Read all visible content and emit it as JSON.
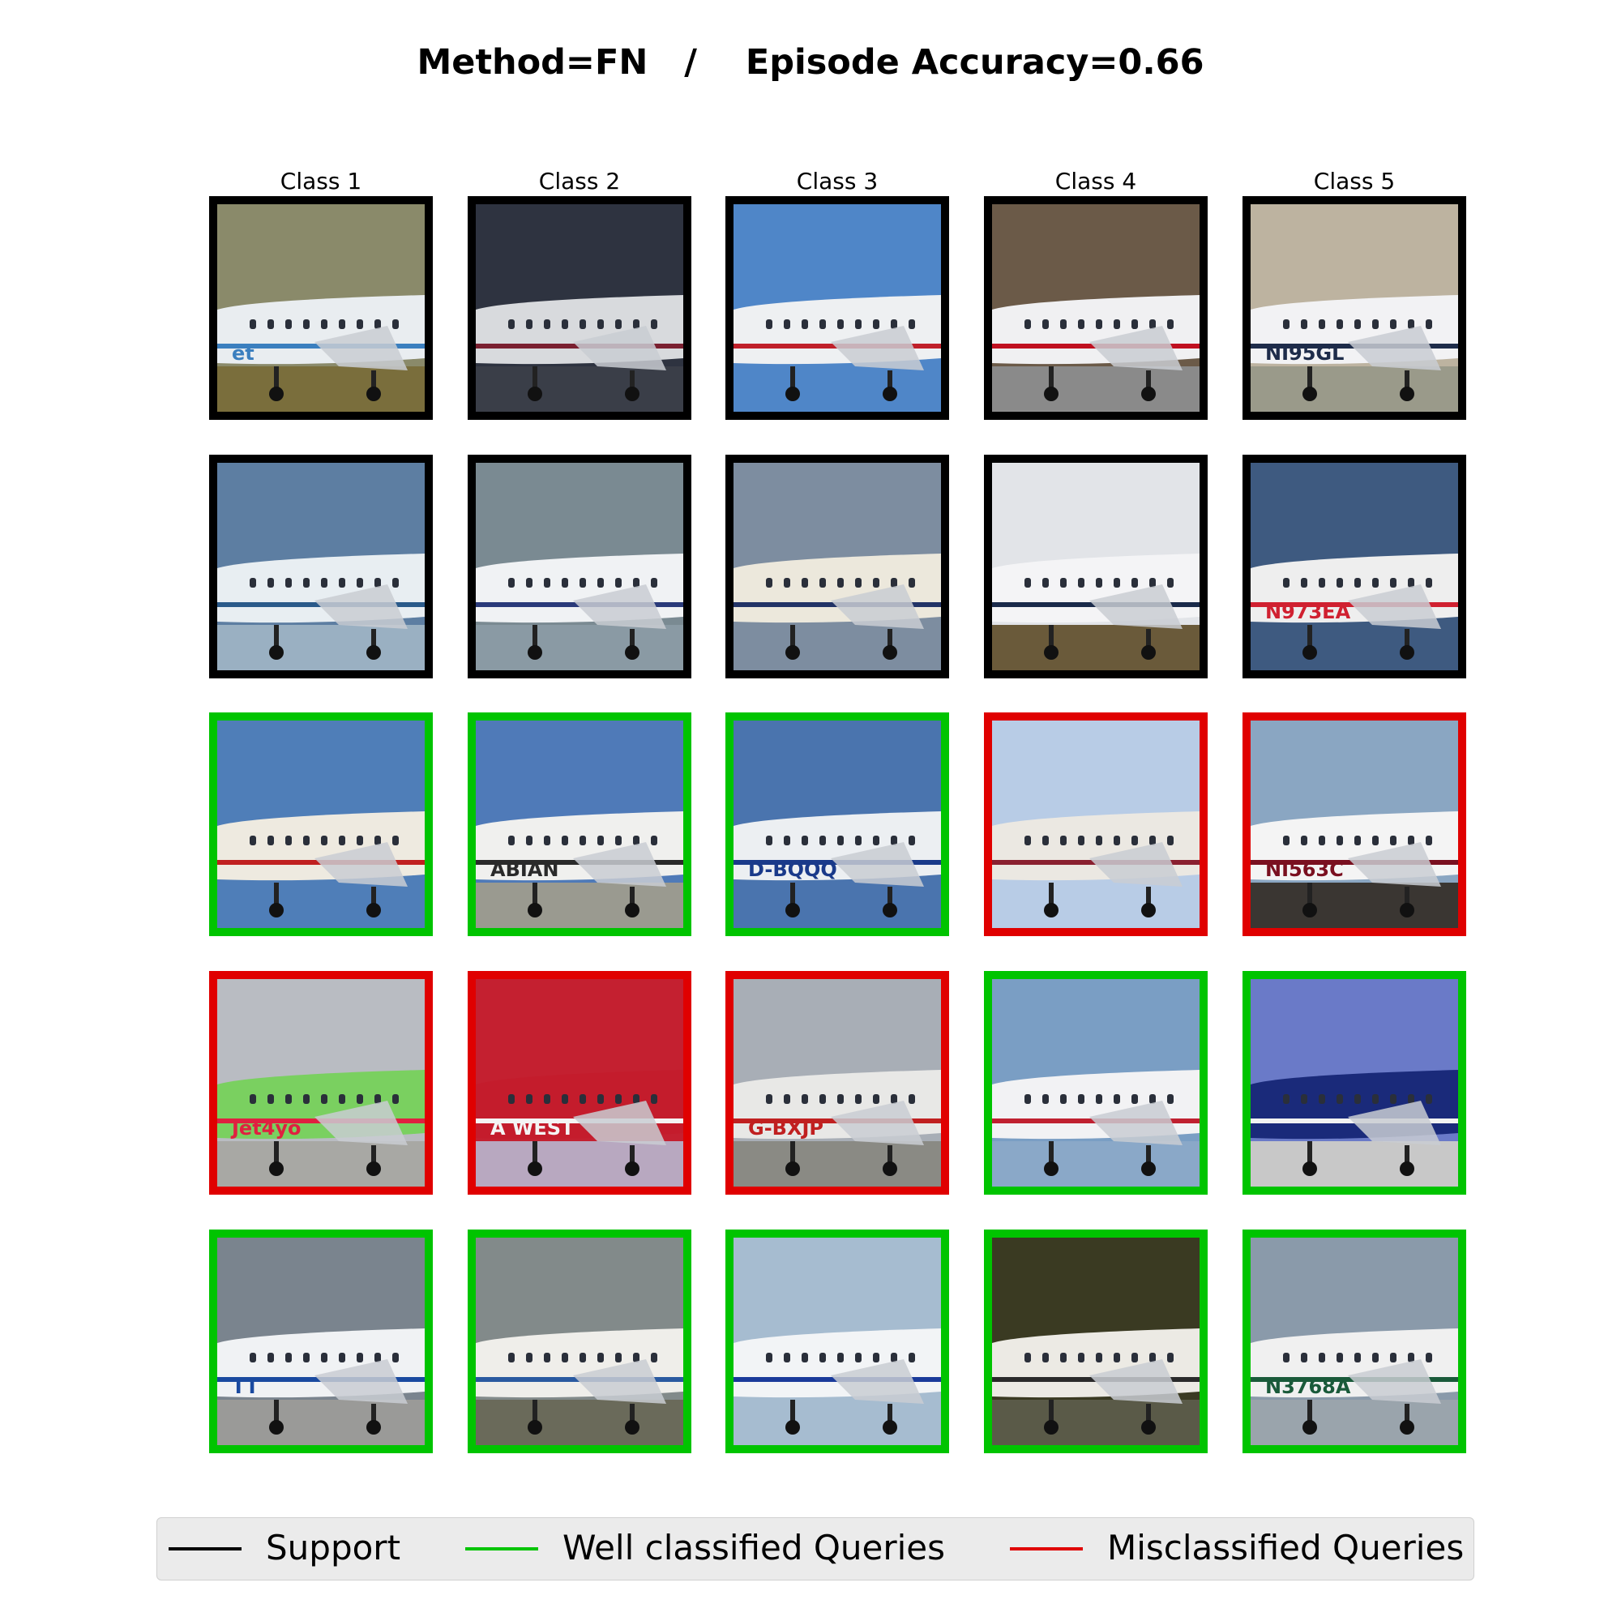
{
  "title": "Method=FN   /    Episode Accuracy=0.66",
  "columns": [
    "Class 1",
    "Class 2",
    "Class 3",
    "Class 4",
    "Class 5"
  ],
  "colors": {
    "support": "#000000",
    "well_classified": "#00c400",
    "misclassified": "#e00000"
  },
  "legend": [
    {
      "label": "Support",
      "color": "#000000"
    },
    {
      "label": "Well classified Queries",
      "color": "#00c400"
    },
    {
      "label": "Misclassified Queries",
      "color": "#e00000"
    }
  ],
  "grid": [
    [
      {
        "status": "support",
        "sky": "#8a8a6a",
        "ground": "#7a6e3c",
        "body": "#e9edf0",
        "stripe": "#3b7fbf",
        "text": "et"
      },
      {
        "status": "support",
        "sky": "#2e3340",
        "ground": "#3a3e48",
        "body": "#d8dadd",
        "stripe": "#7a2030",
        "text": ""
      },
      {
        "status": "support",
        "sky": "#4f86c8",
        "ground": "#4f86c8",
        "body": "#eef0f2",
        "stripe": "#c0202a",
        "text": ""
      },
      {
        "status": "support",
        "sky": "#6b5a48",
        "ground": "#8a8a8a",
        "body": "#f0f0f2",
        "stripe": "#c01020",
        "text": ""
      },
      {
        "status": "support",
        "sky": "#bdb3a0",
        "ground": "#9a9a8a",
        "body": "#f2f2f4",
        "stripe": "#1e2c4a",
        "text": "NI95GL"
      }
    ],
    [
      {
        "status": "support",
        "sky": "#5d7ea2",
        "ground": "#9ab0c2",
        "body": "#e8eef2",
        "stripe": "#2a5a8a",
        "text": ""
      },
      {
        "status": "support",
        "sky": "#7a8a92",
        "ground": "#8a9aa4",
        "body": "#f0f2f4",
        "stripe": "#2a3a7a",
        "text": ""
      },
      {
        "status": "support",
        "sky": "#7d8da0",
        "ground": "#7d8da0",
        "body": "#ece8dc",
        "stripe": "#223366",
        "text": ""
      },
      {
        "status": "support",
        "sky": "#e2e4e8",
        "ground": "#6a5a3a",
        "body": "#f4f4f6",
        "stripe": "#1a2a4a",
        "text": ""
      },
      {
        "status": "support",
        "sky": "#3e5a80",
        "ground": "#3e5a80",
        "body": "#eeeeee",
        "stripe": "#d02030",
        "text": "N973EA"
      }
    ],
    [
      {
        "status": "correct",
        "sky": "#4f7eb8",
        "ground": "#4f7eb8",
        "body": "#eeeae0",
        "stripe": "#c02020",
        "text": ""
      },
      {
        "status": "correct",
        "sky": "#4f7ab8",
        "ground": "#9a9a90",
        "body": "#f0f0ee",
        "stripe": "#2a2a2a",
        "text": "ABIAN"
      },
      {
        "status": "correct",
        "sky": "#4a74ae",
        "ground": "#4a74ae",
        "body": "#eceff2",
        "stripe": "#1a3a8a",
        "text": "D-BQQQ"
      },
      {
        "status": "wrong",
        "sky": "#b8cce6",
        "ground": "#b8cce6",
        "body": "#ebe8e2",
        "stripe": "#8a2030",
        "text": ""
      },
      {
        "status": "wrong",
        "sky": "#8aa6c2",
        "ground": "#3a3632",
        "body": "#f4f4f4",
        "stripe": "#7a1020",
        "text": "NI563C"
      }
    ],
    [
      {
        "status": "wrong",
        "sky": "#b9bcc2",
        "ground": "#a8a8a4",
        "body": "#7ad060",
        "stripe": "#e02040",
        "text": "Jet4yo"
      },
      {
        "status": "wrong",
        "sky": "#c42030",
        "ground": "#b8a8c0",
        "body": "#c41c2c",
        "stripe": "#f4f4f4",
        "text": "A WEST"
      },
      {
        "status": "wrong",
        "sky": "#a8aeb6",
        "ground": "#8a8a84",
        "body": "#e8e8e6",
        "stripe": "#c02020",
        "text": "G-BXJP"
      },
      {
        "status": "correct",
        "sky": "#7a9ec4",
        "ground": "#8aa8c8",
        "body": "#f2f2f4",
        "stripe": "#c02030",
        "text": ""
      },
      {
        "status": "correct",
        "sky": "#6a7ac8",
        "ground": "#c8c8c8",
        "body": "#1a2a7a",
        "stripe": "#f2f2f2",
        "text": ""
      }
    ],
    [
      {
        "status": "correct",
        "sky": "#7a848e",
        "ground": "#9a9a98",
        "body": "#f0f2f4",
        "stripe": "#1a4aa0",
        "text": "TT"
      },
      {
        "status": "correct",
        "sky": "#828a8a",
        "ground": "#6a6a5a",
        "body": "#efeeea",
        "stripe": "#2a5aa0",
        "text": ""
      },
      {
        "status": "correct",
        "sky": "#a6bcd0",
        "ground": "#a6bcd0",
        "body": "#f2f4f6",
        "stripe": "#1a3a9a",
        "text": ""
      },
      {
        "status": "correct",
        "sky": "#3a3a22",
        "ground": "#5a5a48",
        "body": "#eceae4",
        "stripe": "#2a2a2a",
        "text": ""
      },
      {
        "status": "correct",
        "sky": "#8a9aaa",
        "ground": "#9aa4ac",
        "body": "#f0f0f0",
        "stripe": "#1a5a3a",
        "text": "N3768A"
      }
    ]
  ]
}
